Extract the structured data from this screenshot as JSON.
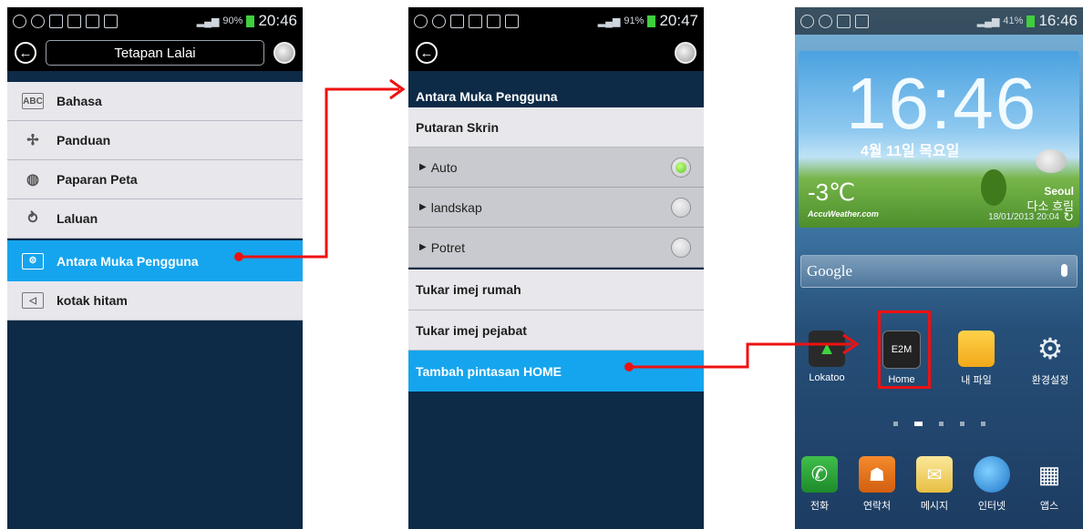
{
  "colors": {
    "statusbar_bg": "#000000",
    "content_bg": "#0d2a47",
    "row_bg": "#e7e7ec",
    "active_row_bg": "#15a5ee",
    "arrow": "#ee1111",
    "radio_selected": "#5ac81f"
  },
  "screen1": {
    "status": {
      "battery": "90%",
      "time": "20:46"
    },
    "appbar": {
      "back_icon": "back-arrow-icon",
      "title": "Tetapan Lalai",
      "globe_icon": "globe-icon"
    },
    "menu": [
      {
        "label": "Bahasa",
        "icon": "abc-icon"
      },
      {
        "label": "Panduan",
        "icon": "guide-icon"
      },
      {
        "label": "Paparan Peta",
        "icon": "globe-settings-icon"
      },
      {
        "label": "Laluan",
        "icon": "route-icon"
      },
      {
        "label": "Antara Muka Pengguna",
        "icon": "interface-icon",
        "active": true
      },
      {
        "label": "kotak hitam",
        "icon": "dashcam-icon"
      }
    ]
  },
  "screen2": {
    "status": {
      "battery": "91%",
      "time": "20:47"
    },
    "section_title": "Antara Muka Pengguna",
    "rotation_header": "Putaran Skrin",
    "rotation_options": [
      {
        "label": "Auto",
        "selected": true
      },
      {
        "label": "landskap",
        "selected": false
      },
      {
        "label": "Potret",
        "selected": false
      }
    ],
    "actions": [
      {
        "label": "Tukar imej rumah"
      },
      {
        "label": "Tukar imej pejabat"
      },
      {
        "label": "Tambah pintasan HOME",
        "active": true
      }
    ]
  },
  "screen3": {
    "status": {
      "battery": "41%",
      "time": "16:46"
    },
    "clock": "16:46",
    "date": "4월 11일 목요일",
    "weather": {
      "temp": "-3℃",
      "brand": "AccuWeather.com",
      "city": "Seoul",
      "condition": "다소 흐림",
      "updated": "18/01/2013 20:04"
    },
    "search_brand": "Google",
    "apps": [
      {
        "label": "Lokatoo",
        "icon": "lokatoo-icon"
      },
      {
        "label": "Home",
        "icon": "e2m-home-icon",
        "icon_text": "E2M",
        "highlighted": true
      },
      {
        "label": "내 파일",
        "icon": "folder-icon"
      },
      {
        "label": "환경설정",
        "icon": "settings-gear-icon"
      }
    ],
    "dock": [
      {
        "label": "전화",
        "icon": "phone-icon"
      },
      {
        "label": "연락처",
        "icon": "contacts-icon"
      },
      {
        "label": "메시지",
        "icon": "message-icon"
      },
      {
        "label": "인터넷",
        "icon": "internet-globe-icon"
      },
      {
        "label": "앱스",
        "icon": "apps-grid-icon"
      }
    ]
  }
}
